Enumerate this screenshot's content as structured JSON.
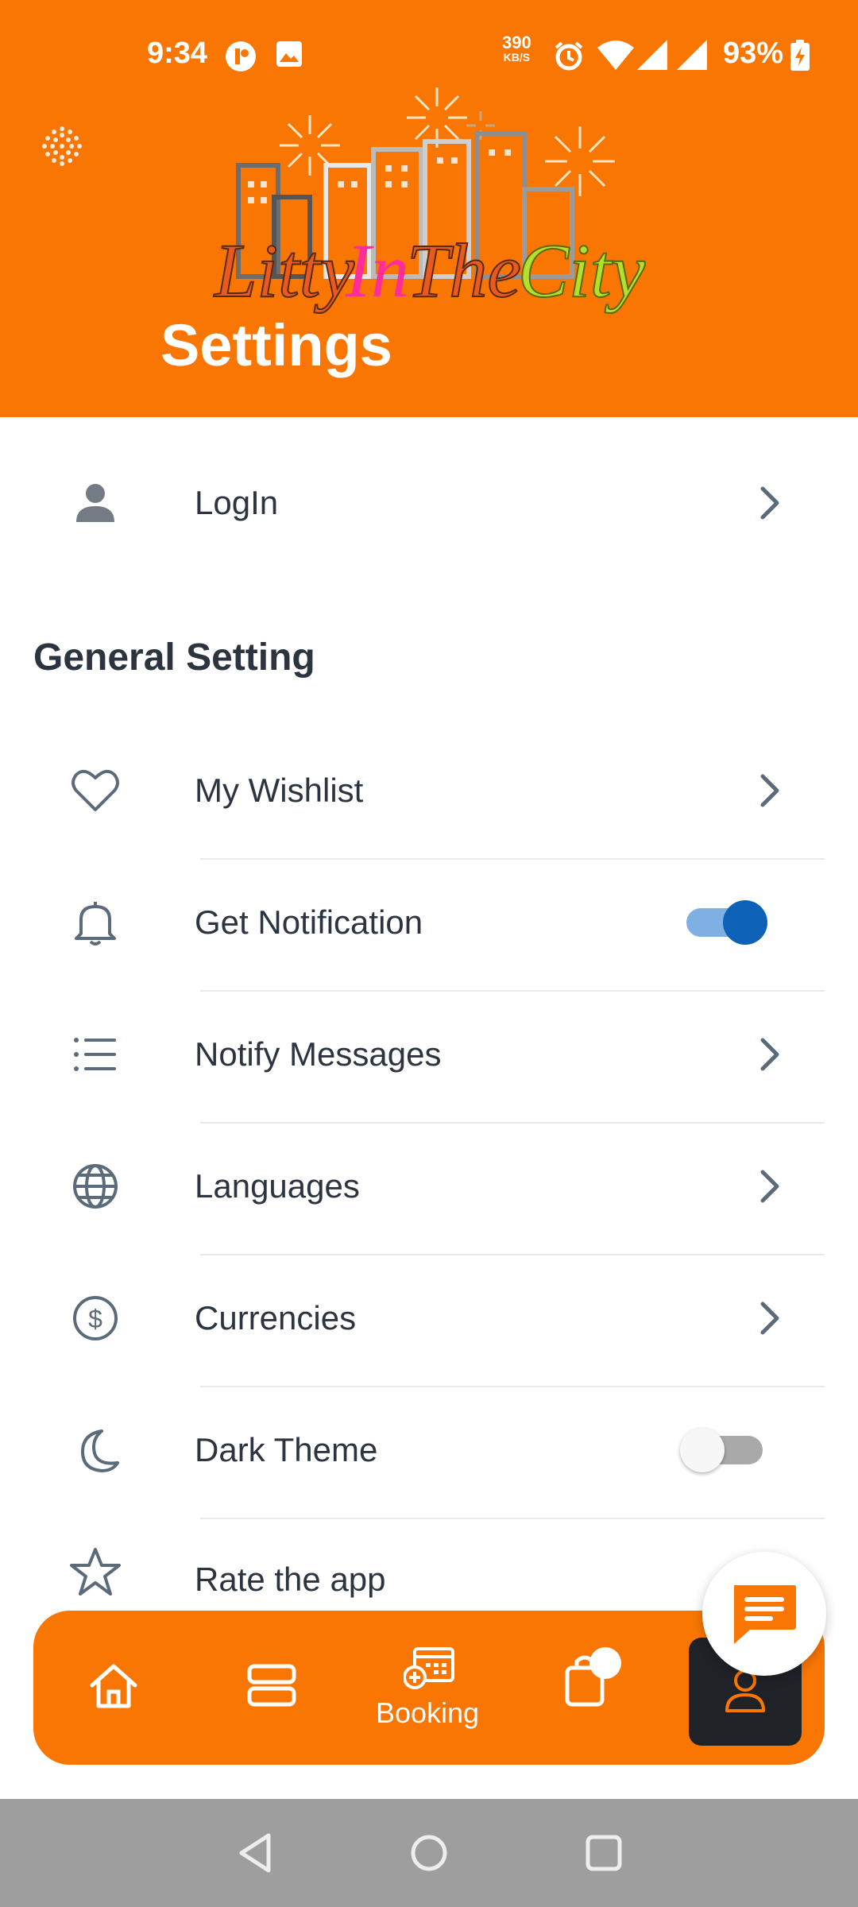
{
  "status_bar": {
    "time": "9:34",
    "speed_value": "390",
    "speed_unit": "KB/S",
    "battery": "93%"
  },
  "header": {
    "title": "Settings",
    "logo_text": "LittyInTheCity",
    "logo_parts": [
      "Litty",
      "In",
      "The",
      "City"
    ],
    "background_color": "#f97602"
  },
  "login": {
    "label": "LogIn",
    "icon": "person-icon"
  },
  "general": {
    "section_title": "General Setting",
    "items": [
      {
        "label": "My Wishlist",
        "icon": "heart-icon",
        "control": "chevron"
      },
      {
        "label": "Get Notification",
        "icon": "bell-icon",
        "control": "toggle",
        "toggled": true
      },
      {
        "label": "Notify Messages",
        "icon": "list-icon",
        "control": "chevron"
      },
      {
        "label": "Languages",
        "icon": "globe-icon",
        "control": "chevron"
      },
      {
        "label": "Currencies",
        "icon": "dollar-icon",
        "control": "chevron"
      },
      {
        "label": "Dark Theme",
        "icon": "moon-icon",
        "control": "toggle",
        "toggled": false
      },
      {
        "label": "Rate the app",
        "icon": "star-icon",
        "control": "none"
      }
    ]
  },
  "bottom_nav": {
    "items": [
      {
        "icon": "home-icon"
      },
      {
        "icon": "list-layout-icon"
      },
      {
        "icon": "calendar-add-icon",
        "label": "Booking"
      },
      {
        "icon": "bag-icon"
      },
      {
        "icon": "profile-icon",
        "active": true
      }
    ]
  },
  "chat_button": {
    "icon": "chat-icon"
  },
  "colors": {
    "accent": "#f97602",
    "toggle_on": "#0d62b8",
    "toggle_on_track": "#7fb0e4",
    "text": "#2c3440",
    "icon": "#5b6b7a"
  }
}
